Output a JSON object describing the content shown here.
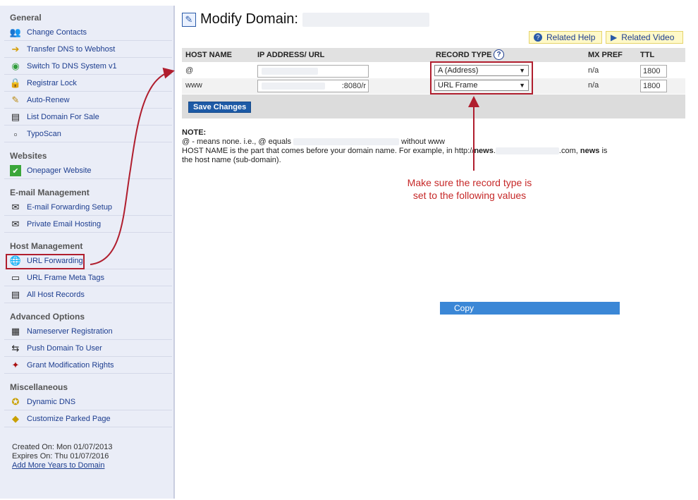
{
  "sidebar": {
    "sections": [
      {
        "title": "General",
        "items": [
          {
            "label": "Change Contacts",
            "icon": "contacts-icon"
          },
          {
            "label": "Transfer DNS to Webhost",
            "icon": "arrow-right-icon"
          },
          {
            "label": "Switch To DNS System v1",
            "icon": "switch-icon"
          },
          {
            "label": "Registrar Lock",
            "icon": "lock-icon"
          },
          {
            "label": "Auto-Renew",
            "icon": "renew-icon"
          },
          {
            "label": "List Domain For Sale",
            "icon": "list-icon"
          },
          {
            "label": "TypoScan",
            "icon": "typoscan-icon"
          }
        ]
      },
      {
        "title": "Websites",
        "items": [
          {
            "label": "Onepager Website",
            "icon": "checkmark-icon"
          }
        ]
      },
      {
        "title": "E-mail Management",
        "items": [
          {
            "label": "E-mail Forwarding Setup",
            "icon": "email-forward-icon"
          },
          {
            "label": "Private Email Hosting",
            "icon": "email-hosting-icon"
          }
        ]
      },
      {
        "title": "Host Management",
        "items": [
          {
            "label": "URL Forwarding",
            "icon": "globe-icon"
          },
          {
            "label": "URL Frame Meta Tags",
            "icon": "frame-icon"
          },
          {
            "label": "All Host Records",
            "icon": "records-icon"
          }
        ]
      },
      {
        "title": "Advanced Options",
        "items": [
          {
            "label": "Nameserver Registration",
            "icon": "nameserver-icon"
          },
          {
            "label": "Push Domain To User",
            "icon": "push-icon"
          },
          {
            "label": "Grant Modification Rights",
            "icon": "rights-icon"
          }
        ]
      },
      {
        "title": "Miscellaneous",
        "items": [
          {
            "label": "Dynamic DNS",
            "icon": "dynamic-dns-icon"
          },
          {
            "label": "Customize Parked Page",
            "icon": "parked-page-icon"
          }
        ]
      }
    ],
    "footer": {
      "created": "Created On: Mon 01/07/2013",
      "expires": "Expires On: Thu 01/07/2016",
      "add_years": "Add More Years to Domain"
    }
  },
  "main": {
    "title": "Modify Domain:",
    "related_help": "Related Help",
    "related_video": "Related Video",
    "columns": [
      "HOST NAME",
      "IP ADDRESS/ URL",
      "RECORD TYPE",
      "MX PREF",
      "TTL"
    ],
    "rows": [
      {
        "host": "@",
        "ip": "",
        "record_type": "A (Address)",
        "mx": "n/a",
        "ttl": "1800"
      },
      {
        "host": "www",
        "ip": ":8080/r",
        "record_type": "URL Frame",
        "mx": "n/a",
        "ttl": "1800"
      }
    ],
    "save_label": "Save Changes",
    "note": {
      "heading": "NOTE:",
      "line1_a": "@ - means none. i.e., @ equals",
      "line1_b": "without www",
      "line2_a": "HOST NAME is the part that comes before your domain name. For example, in http://",
      "line2_b": "news",
      "line2_c": ".",
      "line2_d": ".com,",
      "line2_e": "news",
      "line2_f": "is",
      "line3": "the host name (sub-domain)."
    },
    "annotation_line1": "Make sure the record type is",
    "annotation_line2": "set to the following values",
    "copy_label": "Copy"
  },
  "colors": {
    "accent_red": "#b01e2e",
    "link_blue": "#1c3d8f",
    "save_blue": "#1d5aa6",
    "copy_blue": "#3b87d6"
  }
}
